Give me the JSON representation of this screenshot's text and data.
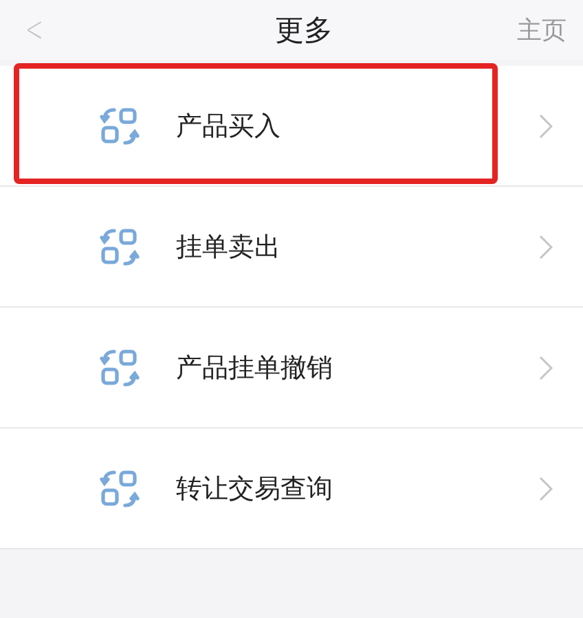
{
  "header": {
    "back": "<",
    "title": "更多",
    "home": "主页"
  },
  "items": [
    {
      "label": "产品买入",
      "highlighted": true
    },
    {
      "label": "挂单卖出",
      "highlighted": false
    },
    {
      "label": "产品挂单撤销",
      "highlighted": false
    },
    {
      "label": "转让交易查询",
      "highlighted": false
    }
  ]
}
